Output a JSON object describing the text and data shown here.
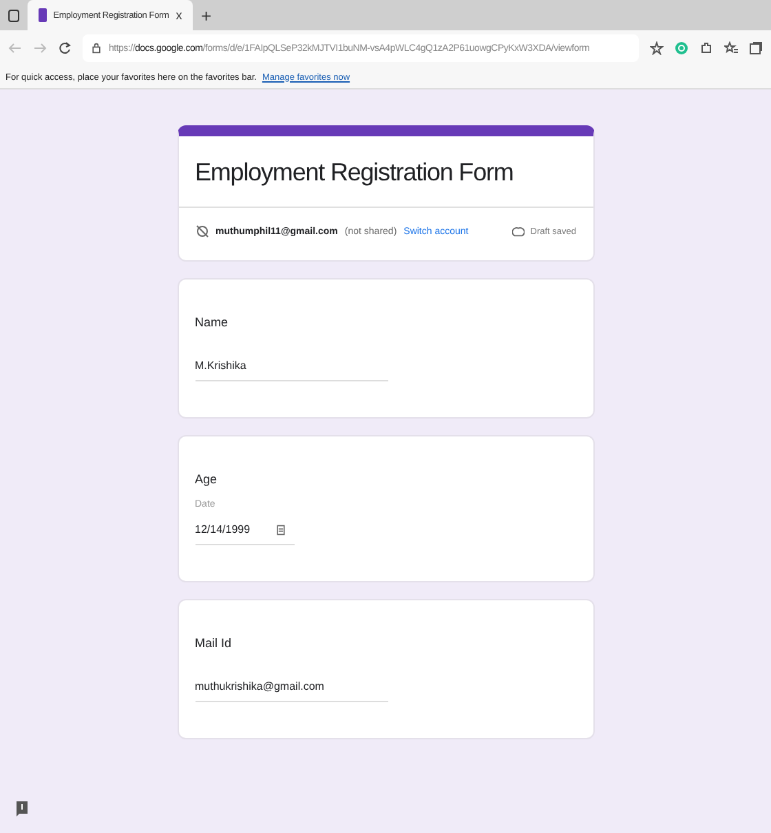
{
  "browser": {
    "tab": {
      "title": "Employment Registration Form",
      "close": "x",
      "selected": true
    },
    "new_tab": "+",
    "url": "https://**docs.google.com**/forms/d/e/1FAIpQLSeP32kMJTVI1buNM-vsA4pWLC4gQ1zA2P61uowgCPyKxW3XDA/viewform",
    "favorites_hint": "For quick access, place your favorites here on the favorites bar.",
    "favorites_link": "Manage favorites now"
  },
  "form": {
    "title": "Employment Registration Form",
    "account": "muthumphil11@gmail.com",
    "not_shared": "(not shared)",
    "switch_account": "Switch account",
    "draft_status": "Draft saved"
  },
  "questions": [
    {
      "kind": "text",
      "label": "Name",
      "value": "M.Krishika"
    },
    {
      "kind": "date",
      "label": "Age",
      "sublabel": "Date",
      "value": "12/14/1999"
    },
    {
      "kind": "text",
      "label": "Mail Id",
      "value": "muthukrishika@gmail.com"
    }
  ]
}
